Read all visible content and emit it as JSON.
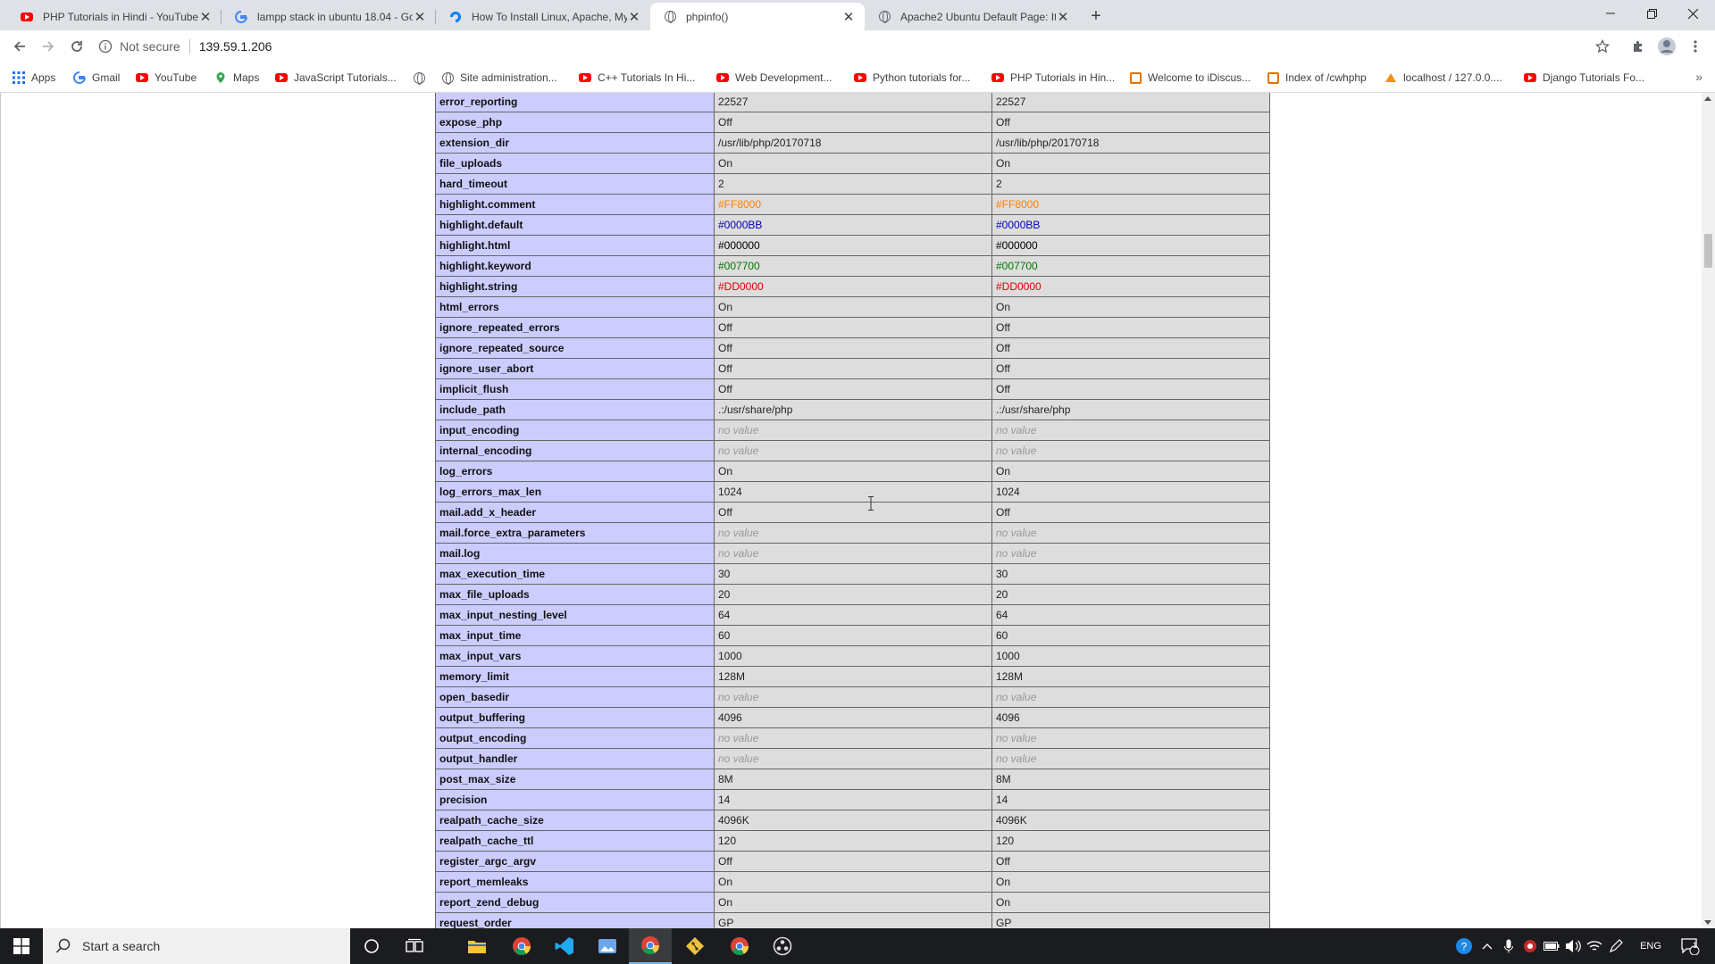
{
  "browser": {
    "tabs": [
      {
        "title": "PHP Tutorials in Hindi - YouTube",
        "favicon": "youtube-icon",
        "active": false
      },
      {
        "title": "lampp stack in ubuntu 18.04 - Go",
        "favicon": "google-icon",
        "active": false
      },
      {
        "title": "How To Install Linux, Apache, My",
        "favicon": "digitalocean-icon",
        "active": false
      },
      {
        "title": "phpinfo()",
        "favicon": "globe-icon",
        "active": true
      },
      {
        "title": "Apache2 Ubuntu Default Page: It",
        "favicon": "globe-icon",
        "active": false
      }
    ],
    "address": {
      "security_label": "Not secure",
      "url": "139.59.1.206"
    },
    "bookmarks": [
      {
        "label": "Apps",
        "icon": "apps-grid-icon"
      },
      {
        "label": "Gmail",
        "icon": "google-icon"
      },
      {
        "label": "YouTube",
        "icon": "youtube-icon"
      },
      {
        "label": "Maps",
        "icon": "maps-icon"
      },
      {
        "label": "JavaScript Tutorials...",
        "icon": "youtube-icon"
      },
      {
        "label": "",
        "icon": "globe-icon"
      },
      {
        "label": "Site administration...",
        "icon": "globe-icon"
      },
      {
        "label": "C++ Tutorials In Hi...",
        "icon": "youtube-icon"
      },
      {
        "label": "Web Development...",
        "icon": "youtube-icon"
      },
      {
        "label": "Python tutorials for...",
        "icon": "youtube-icon"
      },
      {
        "label": "PHP Tutorials in Hin...",
        "icon": "youtube-icon"
      },
      {
        "label": "Welcome to iDiscus...",
        "icon": "box-icon"
      },
      {
        "label": "Index of /cwhphp",
        "icon": "box-icon"
      },
      {
        "label": "localhost / 127.0.0....",
        "icon": "phpmyadmin-icon"
      },
      {
        "label": "Django Tutorials Fo...",
        "icon": "youtube-icon"
      }
    ]
  },
  "phpinfo": {
    "no_value_text": "no value",
    "rows": [
      {
        "directive": "error_reporting",
        "local": "22527",
        "master": "22527"
      },
      {
        "directive": "expose_php",
        "local": "Off",
        "master": "Off"
      },
      {
        "directive": "extension_dir",
        "local": "/usr/lib/php/20170718",
        "master": "/usr/lib/php/20170718"
      },
      {
        "directive": "file_uploads",
        "local": "On",
        "master": "On"
      },
      {
        "directive": "hard_timeout",
        "local": "2",
        "master": "2"
      },
      {
        "directive": "highlight.comment",
        "local": "#FF8000",
        "master": "#FF8000",
        "color": "#FF8000"
      },
      {
        "directive": "highlight.default",
        "local": "#0000BB",
        "master": "#0000BB",
        "color": "#0000BB"
      },
      {
        "directive": "highlight.html",
        "local": "#000000",
        "master": "#000000",
        "color": "#000000"
      },
      {
        "directive": "highlight.keyword",
        "local": "#007700",
        "master": "#007700",
        "color": "#007700"
      },
      {
        "directive": "highlight.string",
        "local": "#DD0000",
        "master": "#DD0000",
        "color": "#DD0000"
      },
      {
        "directive": "html_errors",
        "local": "On",
        "master": "On"
      },
      {
        "directive": "ignore_repeated_errors",
        "local": "Off",
        "master": "Off"
      },
      {
        "directive": "ignore_repeated_source",
        "local": "Off",
        "master": "Off"
      },
      {
        "directive": "ignore_user_abort",
        "local": "Off",
        "master": "Off"
      },
      {
        "directive": "implicit_flush",
        "local": "Off",
        "master": "Off"
      },
      {
        "directive": "include_path",
        "local": ".:/usr/share/php",
        "master": ".:/usr/share/php"
      },
      {
        "directive": "input_encoding",
        "local": null,
        "master": null
      },
      {
        "directive": "internal_encoding",
        "local": null,
        "master": null
      },
      {
        "directive": "log_errors",
        "local": "On",
        "master": "On"
      },
      {
        "directive": "log_errors_max_len",
        "local": "1024",
        "master": "1024"
      },
      {
        "directive": "mail.add_x_header",
        "local": "Off",
        "master": "Off"
      },
      {
        "directive": "mail.force_extra_parameters",
        "local": null,
        "master": null
      },
      {
        "directive": "mail.log",
        "local": null,
        "master": null
      },
      {
        "directive": "max_execution_time",
        "local": "30",
        "master": "30"
      },
      {
        "directive": "max_file_uploads",
        "local": "20",
        "master": "20"
      },
      {
        "directive": "max_input_nesting_level",
        "local": "64",
        "master": "64"
      },
      {
        "directive": "max_input_time",
        "local": "60",
        "master": "60"
      },
      {
        "directive": "max_input_vars",
        "local": "1000",
        "master": "1000"
      },
      {
        "directive": "memory_limit",
        "local": "128M",
        "master": "128M"
      },
      {
        "directive": "open_basedir",
        "local": null,
        "master": null
      },
      {
        "directive": "output_buffering",
        "local": "4096",
        "master": "4096"
      },
      {
        "directive": "output_encoding",
        "local": null,
        "master": null
      },
      {
        "directive": "output_handler",
        "local": null,
        "master": null
      },
      {
        "directive": "post_max_size",
        "local": "8M",
        "master": "8M"
      },
      {
        "directive": "precision",
        "local": "14",
        "master": "14"
      },
      {
        "directive": "realpath_cache_size",
        "local": "4096K",
        "master": "4096K"
      },
      {
        "directive": "realpath_cache_ttl",
        "local": "120",
        "master": "120"
      },
      {
        "directive": "register_argc_argv",
        "local": "Off",
        "master": "Off"
      },
      {
        "directive": "report_memleaks",
        "local": "On",
        "master": "On"
      },
      {
        "directive": "report_zend_debug",
        "local": "On",
        "master": "On"
      },
      {
        "directive": "request_order",
        "local": "GP",
        "master": "GP"
      }
    ]
  },
  "taskbar": {
    "search_placeholder": "Start a search",
    "apps": [
      "cortana-icon",
      "task-view-icon",
      "file-explorer-icon",
      "chrome-icon",
      "vscode-icon",
      "photos-icon",
      "chrome-active-icon",
      "git-icon",
      "chrome-icon",
      "obs-icon"
    ],
    "language": "ENG",
    "notification_count": "1"
  }
}
